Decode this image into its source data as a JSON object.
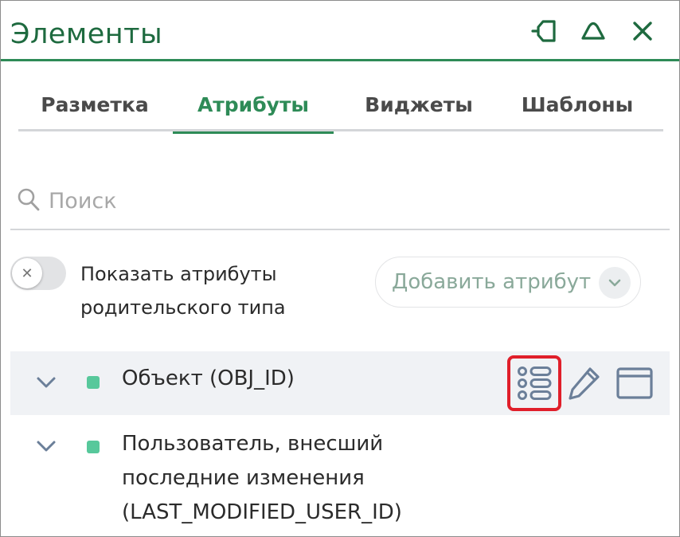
{
  "header": {
    "title": "Элементы",
    "icons": [
      "pin-icon",
      "collapse-icon",
      "close-icon"
    ]
  },
  "tabs": [
    {
      "label": "Разметка",
      "active": false
    },
    {
      "label": "Атрибуты",
      "active": true
    },
    {
      "label": "Виджеты",
      "active": false
    },
    {
      "label": "Шаблоны",
      "active": false
    }
  ],
  "search": {
    "placeholder": "Поиск",
    "value": ""
  },
  "toggle": {
    "label_line1": "Показать атрибуты",
    "label_line2": "родительского типа",
    "state": "off"
  },
  "add_attribute": {
    "label": "Добавить атрибут"
  },
  "attributes": [
    {
      "label": "Объект (OBJ_ID)",
      "status_color": "#57c89b",
      "actions": [
        "list-layout-icon",
        "edit-pencil-icon",
        "window-icon"
      ],
      "highlighted_action": "list-layout-icon"
    },
    {
      "label_line1": "Пользователь, внесший",
      "label_line2": "последние изменения",
      "label_line3": "(LAST_MODIFIED_USER_ID)",
      "status_color": "#57c89b"
    }
  ],
  "colors": {
    "accent": "#2e8b57",
    "title": "#1e6a3f",
    "highlight": "#e01f2a",
    "dot": "#57c89b"
  }
}
